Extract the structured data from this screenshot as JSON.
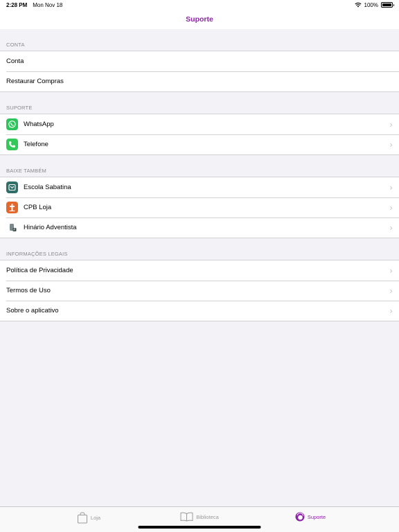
{
  "status": {
    "time": "2:28 PM",
    "date": "Mon Nov 18",
    "battery": "100%"
  },
  "nav": {
    "title": "Suporte"
  },
  "sections": {
    "conta": {
      "header": "CONTA",
      "items": [
        "Conta",
        "Restaurar Compras"
      ]
    },
    "suporte": {
      "header": "SUPORTE",
      "items": [
        "WhatsApp",
        "Telefone"
      ]
    },
    "baixe": {
      "header": "BAIXE TAMBÉM",
      "items": [
        "Escola Sabatina",
        "CPB Loja",
        "Hinário Adventista"
      ]
    },
    "legais": {
      "header": "INFORMAÇÕES LEGAIS",
      "items": [
        "Política de Privacidade",
        "Termos de Uso",
        "Sobre o aplicativo"
      ]
    }
  },
  "tabs": {
    "loja": "Loja",
    "biblioteca": "Biblioteca",
    "suporte": "Suporte"
  },
  "colors": {
    "accent": "#8e24aa",
    "background": "#f2f2f7"
  }
}
